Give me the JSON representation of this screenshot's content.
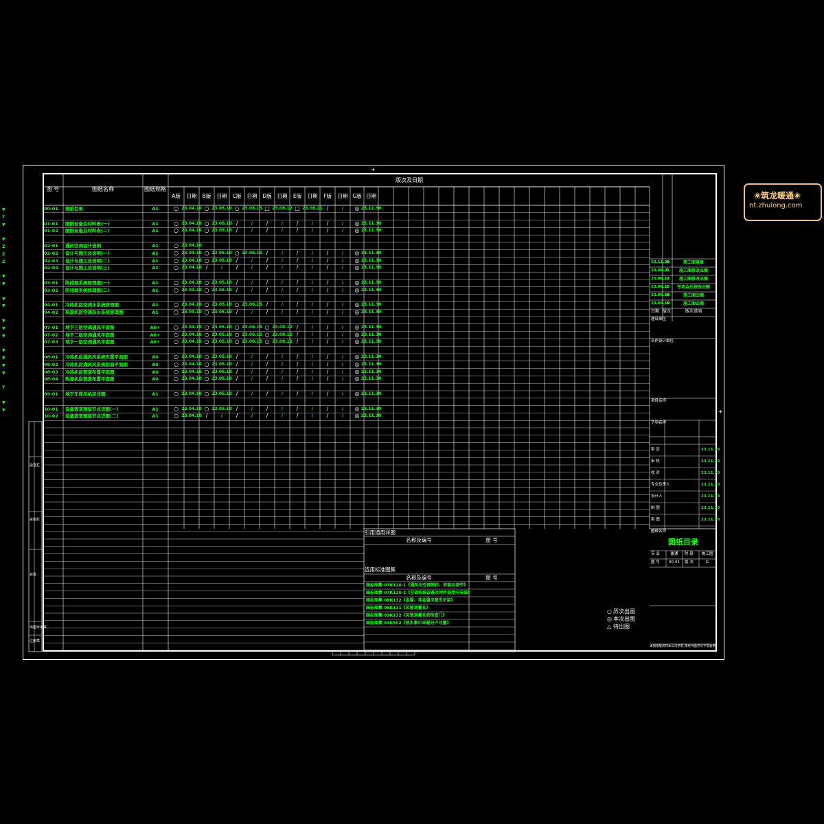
{
  "header": {
    "col_drawing_no": "图 号",
    "col_drawing_name": "图纸名称",
    "col_spec": "图纸规格",
    "col_revisions": "版次及日期",
    "rev_columns": [
      "A版",
      "日期",
      "B版",
      "日期",
      "C版",
      "日期",
      "D版",
      "日期",
      "E版",
      "日期",
      "F版",
      "日期",
      "G版",
      "日期"
    ]
  },
  "rows": [
    {
      "no": "00-01",
      "name": "图纸目录",
      "spec": "A1",
      "a": "○",
      "ad": "23.04.10",
      "b": "○",
      "bd": "23.05.10",
      "c": "○",
      "cd": "23.06.15",
      "d": "□",
      "dd": "23.08.12",
      "e": "□",
      "ed": "23.08.21",
      "f": "/",
      "fd": "/",
      "g": "◎",
      "gd": "23.11.30"
    },
    {
      "gap": true
    },
    {
      "no": "01-01",
      "name": "图例设备及材料表(一)",
      "spec": "A1",
      "a": "○",
      "ad": "23.04.10",
      "b": "○",
      "bd": "23.05.10",
      "c": "/",
      "cd": "/",
      "d": "/",
      "dd": "/",
      "e": "/",
      "ed": "/",
      "f": "/",
      "fd": "/",
      "g": "◎",
      "gd": "23.11.30"
    },
    {
      "no": "01-02",
      "name": "图例设备及材料表(二)",
      "spec": "A1",
      "a": "○",
      "ad": "23.04.10",
      "b": "○",
      "bd": "23.05.10",
      "c": "/",
      "cd": "/",
      "d": "/",
      "dd": "/",
      "e": "/",
      "ed": "/",
      "f": "/",
      "fd": "/",
      "g": "◎",
      "gd": "23.11.30"
    },
    {
      "gap": true
    },
    {
      "no": "02-01",
      "name": "通风空调设计说明",
      "spec": "A1",
      "a": "○",
      "ad": "23.04.10",
      "b": "",
      "bd": "",
      "c": "",
      "cd": "",
      "d": "",
      "dd": "",
      "e": "",
      "ed": "",
      "f": "",
      "fd": "",
      "g": "",
      "gd": ""
    },
    {
      "no": "02-02",
      "name": "设计与施工总说明(一)",
      "spec": "A1",
      "a": "○",
      "ad": "23.04.10",
      "b": "○",
      "bd": "23.05.10",
      "c": "○",
      "cd": "23.06.15",
      "d": "/",
      "dd": "/",
      "e": "/",
      "ed": "/",
      "f": "/",
      "fd": "/",
      "g": "◎",
      "gd": "23.11.30"
    },
    {
      "no": "02-03",
      "name": "设计与施工总说明(二)",
      "spec": "A1",
      "a": "○",
      "ad": "23.04.10",
      "b": "○",
      "bd": "23.05.10",
      "c": "/",
      "cd": "/",
      "d": "/",
      "dd": "/",
      "e": "/",
      "ed": "/",
      "f": "/",
      "fd": "/",
      "g": "◎",
      "gd": "23.11.30"
    },
    {
      "no": "02-04",
      "name": "设计与施工总说明(三)",
      "spec": "A1",
      "a": "○",
      "ad": "23.04.10",
      "b": "/",
      "bd": "/",
      "c": "/",
      "cd": "/",
      "d": "/",
      "dd": "/",
      "e": "/",
      "ed": "/",
      "f": "/",
      "fd": "/",
      "g": "◎",
      "gd": "23.11.30"
    },
    {
      "gap": true
    },
    {
      "no": "03-01",
      "name": "防排烟系统原理图(一)",
      "spec": "A1",
      "a": "○",
      "ad": "23.04.10",
      "b": "○",
      "bd": "23.05.10",
      "c": "/",
      "cd": "/",
      "d": "/",
      "dd": "/",
      "e": "/",
      "ed": "/",
      "f": "/",
      "fd": "/",
      "g": "◎",
      "gd": "23.11.30"
    },
    {
      "no": "03-02",
      "name": "防排烟系统原理图(二)",
      "spec": "A1",
      "a": "○",
      "ad": "23.04.10",
      "b": "○",
      "bd": "23.05.10",
      "c": "/",
      "cd": "/",
      "d": "/",
      "dd": "/",
      "e": "/",
      "ed": "/",
      "f": "/",
      "fd": "/",
      "g": "◎",
      "gd": "23.11.30"
    },
    {
      "gap": true
    },
    {
      "no": "04-01",
      "name": "冷热机房空调水系统原理图",
      "spec": "A1",
      "a": "○",
      "ad": "23.04.10",
      "b": "○",
      "bd": "23.05.10",
      "c": "○",
      "cd": "23.06.15",
      "d": "/",
      "dd": "/",
      "e": "/",
      "ed": "/",
      "f": "/",
      "fd": "/",
      "g": "◎",
      "gd": "23.11.30"
    },
    {
      "no": "04-02",
      "name": "热源机房空调热水系统原理图",
      "spec": "A1",
      "a": "○",
      "ad": "23.04.10",
      "b": "○",
      "bd": "23.05.10",
      "c": "/",
      "cd": "/",
      "d": "/",
      "dd": "/",
      "e": "/",
      "ed": "/",
      "f": "/",
      "fd": "/",
      "g": "◎",
      "gd": "23.11.30"
    },
    {
      "gap": true
    },
    {
      "no": "07-01",
      "name": "地下三层空调通风平面图",
      "spec": "A0+",
      "a": "○",
      "ad": "23.04.10",
      "b": "○",
      "bd": "23.05.10",
      "c": "○",
      "cd": "23.06.15",
      "d": "○",
      "dd": "23.08.12",
      "e": "/",
      "ed": "/",
      "f": "/",
      "fd": "/",
      "g": "◎",
      "gd": "23.11.30"
    },
    {
      "no": "07-02",
      "name": "地下二层空调通风平面图",
      "spec": "A0+",
      "a": "○",
      "ad": "23.04.10",
      "b": "○",
      "bd": "23.05.10",
      "c": "○",
      "cd": "23.06.15",
      "d": "○",
      "dd": "23.08.12",
      "e": "/",
      "ed": "/",
      "f": "/",
      "fd": "/",
      "g": "◎",
      "gd": "23.11.30"
    },
    {
      "no": "07-03",
      "name": "地下一层空调通风平面图",
      "spec": "A0+",
      "a": "○",
      "ad": "23.04.10",
      "b": "○",
      "bd": "23.05.10",
      "c": "○",
      "cd": "23.06.15",
      "d": "○",
      "dd": "23.08.12",
      "e": "/",
      "ed": "/",
      "f": "/",
      "fd": "/",
      "g": "◎",
      "gd": "23.11.30"
    },
    {
      "gap": true
    },
    {
      "no": "08-01",
      "name": "冷热机房通风风系统布置平面图",
      "spec": "A0",
      "a": "○",
      "ad": "23.04.10",
      "b": "○",
      "bd": "23.05.10",
      "c": "/",
      "cd": "/",
      "d": "/",
      "dd": "/",
      "e": "/",
      "ed": "/",
      "f": "/",
      "fd": "/",
      "g": "◎",
      "gd": "23.11.30"
    },
    {
      "no": "08-02",
      "name": "冷热机房通风风系统剖面平面图",
      "spec": "A0",
      "a": "○",
      "ad": "23.04.10",
      "b": "○",
      "bd": "23.05.10",
      "c": "/",
      "cd": "/",
      "d": "/",
      "dd": "/",
      "e": "/",
      "ed": "/",
      "f": "/",
      "fd": "/",
      "g": "◎",
      "gd": "23.11.30"
    },
    {
      "no": "08-03",
      "name": "冷热机房管道布置平面图",
      "spec": "A0",
      "a": "○",
      "ad": "23.04.10",
      "b": "○",
      "bd": "23.05.10",
      "c": "/",
      "cd": "/",
      "d": "/",
      "dd": "/",
      "e": "/",
      "ed": "/",
      "f": "/",
      "fd": "/",
      "g": "◎",
      "gd": "23.11.30"
    },
    {
      "no": "08-04",
      "name": "热源机房管道布置平面图",
      "spec": "A0",
      "a": "○",
      "ad": "23.04.10",
      "b": "○",
      "bd": "23.05.10",
      "c": "/",
      "cd": "/",
      "d": "/",
      "dd": "/",
      "e": "/",
      "ed": "/",
      "f": "/",
      "fd": "/",
      "g": "◎",
      "gd": "23.11.30"
    },
    {
      "gap": true
    },
    {
      "no": "09-01",
      "name": "地下车库风机房详图",
      "spec": "A1",
      "a": "○",
      "ad": "23.04.10",
      "b": "○",
      "bd": "23.05.10",
      "c": "/",
      "cd": "/",
      "d": "/",
      "dd": "/",
      "e": "/",
      "ed": "/",
      "f": "/",
      "fd": "/",
      "g": "◎",
      "gd": "23.11.30"
    },
    {
      "gap": true
    },
    {
      "no": "10-01",
      "name": "设备管道预留节点详图(一)",
      "spec": "A1",
      "a": "○",
      "ad": "23.04.10",
      "b": "○",
      "bd": "23.05.10",
      "c": "/",
      "cd": "/",
      "d": "/",
      "dd": "/",
      "e": "/",
      "ed": "/",
      "f": "/",
      "fd": "/",
      "g": "◎",
      "gd": "23.11.30"
    },
    {
      "no": "10-02",
      "name": "设备管道预留节点详图(二)",
      "spec": "A1",
      "a": "○",
      "ad": "23.04.10",
      "b": "/",
      "bd": "/",
      "c": "/",
      "cd": "/",
      "d": "/",
      "dd": "/",
      "e": "/",
      "ed": "/",
      "f": "/",
      "fd": "/",
      "g": "◎",
      "gd": "23.11.30"
    }
  ],
  "common_details": {
    "title": "引用通用详图",
    "col_name": "名称及编号",
    "col_no": "图 号"
  },
  "standard_sets": {
    "title": "选用标准图集",
    "col_name": "名称及编号",
    "col_no": "图 号",
    "items": [
      "国标图集 07K120-1《通风与空调制作、安装与调节》",
      "国标图集 07K120-2《空调系统设备及附件选用与安装》",
      "国标图集 08K132《金属、非金属风管支吊架》",
      "国标图集 06K131《风管测量孔》",
      "国标图集 03K132《风管测量孔和检查门》",
      "国标图集 04K502《热水集中采暖分户计量》"
    ]
  },
  "legend": [
    {
      "symbol": "○",
      "label": "历次出图"
    },
    {
      "symbol": "◎",
      "label": "本次出图"
    },
    {
      "symbol": "△",
      "label": "待出图"
    }
  ],
  "title_block": {
    "revisions": [
      {
        "date": "23.11.30",
        "ver": "G",
        "desc": "施工图盖章"
      },
      {
        "date": "23.08.21",
        "ver": "E",
        "desc": "施工图修改出图"
      },
      {
        "date": "23.08.12",
        "ver": "D",
        "desc": "施工图修改出图"
      },
      {
        "date": "23.06.15",
        "ver": "C",
        "desc": "专项会后修改出图"
      },
      {
        "date": "23.05.10",
        "ver": "B",
        "desc": "施工图出图"
      },
      {
        "date": "23.04.10",
        "ver": "A",
        "desc": "施工图出图"
      }
    ],
    "rev_header": [
      "日期",
      "版次",
      "版次说明"
    ],
    "construction_unit_label": "建设单位",
    "design_unit_label": "合作设计单位",
    "project_name_label": "项目名称",
    "sub_item_label": "子项名称",
    "sign_rows": [
      {
        "label": "审 定",
        "date": "23.11.30"
      },
      {
        "label": "审 核",
        "date": "23.11.30"
      },
      {
        "label": "校 对",
        "date": "23.11.30"
      },
      {
        "label": "专业负责人",
        "date": "23.11.30"
      },
      {
        "label": "设计人",
        "date": "23.11.30"
      },
      {
        "label": "制 图",
        "date": "23.11.30"
      },
      {
        "label": "审 图",
        "date": "23.11.30"
      }
    ],
    "drawing_title_label": "图纸名称",
    "drawing_title": "图纸目录",
    "major_label": "专 业",
    "major_value": "暖通",
    "stage_label": "阶 段",
    "stage_value": "施工图",
    "no_label": "图 号",
    "no_value": "00-01",
    "ver_label": "版 次",
    "ver_value": "G",
    "footer": "本图纸版权归本公司所有,未经书面许可不得复制"
  },
  "left_stamp_labels": [
    "会签栏",
    "会签栏",
    "会签",
    "出图专用章",
    "注册章"
  ],
  "left_margin_marks": [
    "▼",
    "T",
    "▼",
    "",
    "▼",
    "Z",
    "Z",
    "Z",
    "",
    "▼",
    "▼",
    "",
    "▼",
    "▼",
    "",
    "▼",
    "▼",
    "▼",
    "",
    "▼",
    "▼",
    "▼",
    "▼",
    "",
    "T",
    "",
    "▼",
    "▼"
  ],
  "watermark": {
    "line1": "❀筑龙暖通❀",
    "line2": "nt.zhulong.com"
  },
  "colors": {
    "background": "#000000",
    "lines": "#ffffff",
    "text_green": "#18ff18",
    "logo": "#ffd080"
  }
}
